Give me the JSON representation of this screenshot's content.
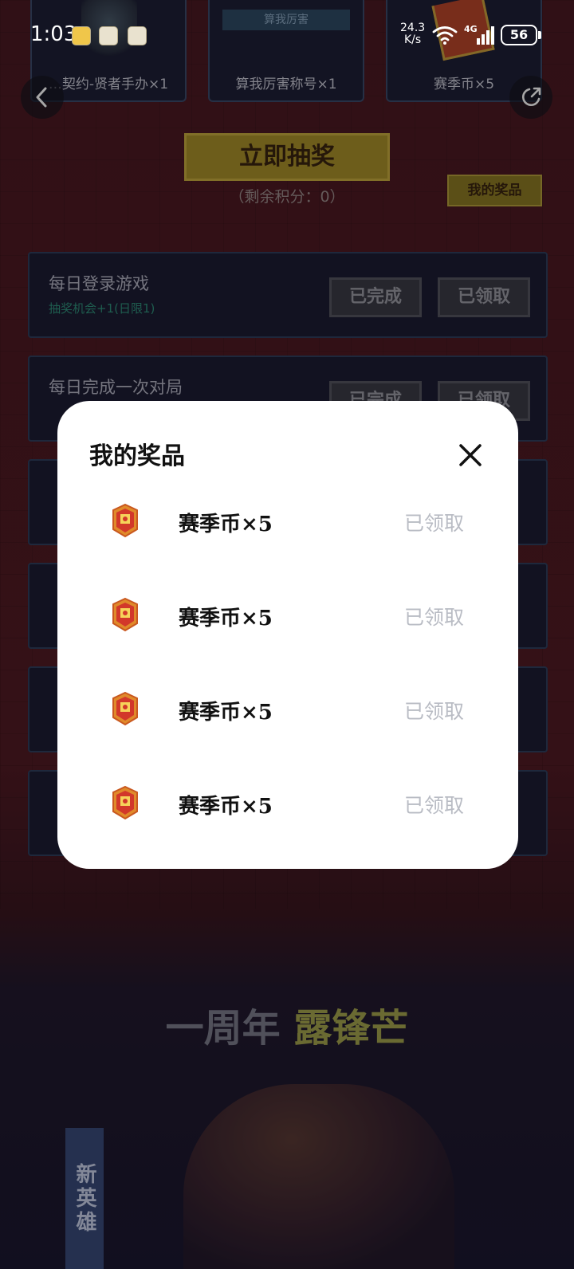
{
  "status_bar": {
    "time": "1:03",
    "net_speed_value": "24.3",
    "net_speed_unit": "K/s",
    "network_type": "4G",
    "battery": "56"
  },
  "top_prizes": [
    {
      "label": "…契约-贤者手办×1"
    },
    {
      "tag": "算我厉害",
      "label": "算我厉害称号×1"
    },
    {
      "label": "赛季币×5"
    }
  ],
  "draw": {
    "button_label": "立即抽奖",
    "points_text": "（剩余积分：0）",
    "my_prizes_label": "我的奖品"
  },
  "tasks": [
    {
      "title": "每日登录游戏",
      "subtitle": "抽奖机会+1(日限1)",
      "complete_label": "已完成",
      "claim_label": "已领取"
    },
    {
      "title": "每日完成一次对局",
      "subtitle": "",
      "complete_label": "已完成",
      "claim_label": "已领取"
    }
  ],
  "banner": {
    "anniversary_prefix": "一周年",
    "anniversary_highlight": "露锋芒",
    "new_hero": "新英雄"
  },
  "modal": {
    "title": "我的奖品",
    "items": [
      {
        "name": "赛季币×5",
        "status": "已领取",
        "icon": "season-coin-icon"
      },
      {
        "name": "赛季币×5",
        "status": "已领取",
        "icon": "season-coin-icon"
      },
      {
        "name": "赛季币×5",
        "status": "已领取",
        "icon": "season-coin-icon"
      },
      {
        "name": "赛季币×5",
        "status": "已领取",
        "icon": "season-coin-icon"
      }
    ]
  },
  "colors": {
    "page_red": "#511b24",
    "gold": "#a88f2a",
    "card_navy": "#1d1d33",
    "modal_bg": "#ffffff",
    "claimed_gray": "#b9bcc4"
  }
}
